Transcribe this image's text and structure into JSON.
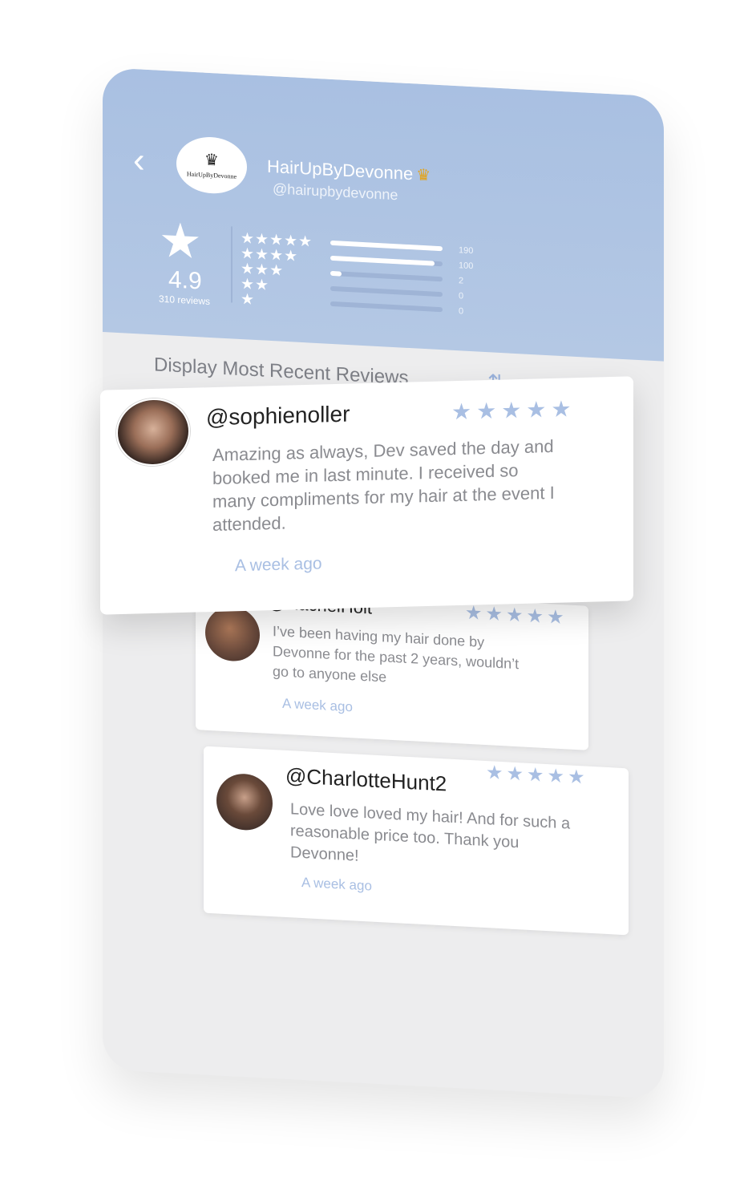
{
  "header": {
    "back_icon": "chevron-left-icon",
    "logo_text": "HairUpByDevonne",
    "business_name": "HairUpByDevonne",
    "crown_icon": "crown-icon",
    "handle": "@hairupbydevonne"
  },
  "summary": {
    "rating": "4.9",
    "reviews_label": "310 reviews",
    "star_icon": "star-icon"
  },
  "distribution": [
    {
      "stars": "★★★★★",
      "count": "190",
      "fill": 1.0
    },
    {
      "stars": "★★★★",
      "count": "100",
      "fill": 0.93
    },
    {
      "stars": "★★★",
      "count": "2",
      "fill": 0.1
    },
    {
      "stars": "★★",
      "count": "0",
      "fill": 0
    },
    {
      "stars": "★",
      "count": "0",
      "fill": 0
    }
  ],
  "sort": {
    "label": "Display Most Recent Reviews",
    "icon": "sort-arrows-icon"
  },
  "reviews": [
    {
      "handle": "@sophienoller",
      "stars": "★★★★★",
      "body": "Amazing as always, Dev saved the day and booked me in last minute. I received so many compliments for my hair at the event I attended.",
      "time": "A week ago"
    },
    {
      "handle": "@RachelHolt",
      "stars": "★★★★★",
      "body": "I’ve been having my hair done by Devonne for the past 2 years, wouldn’t go to anyone else",
      "time": "A week ago"
    },
    {
      "handle": "@CharlotteHunt2",
      "stars": "★★★★★",
      "body": "Love love loved my hair! And for such a reasonable price too. Thank you Devonne!",
      "time": "A week ago"
    }
  ],
  "colors": {
    "accent": "#a9bfe3",
    "header_bg": "#adc3e3",
    "phone_bg": "#ededee"
  }
}
